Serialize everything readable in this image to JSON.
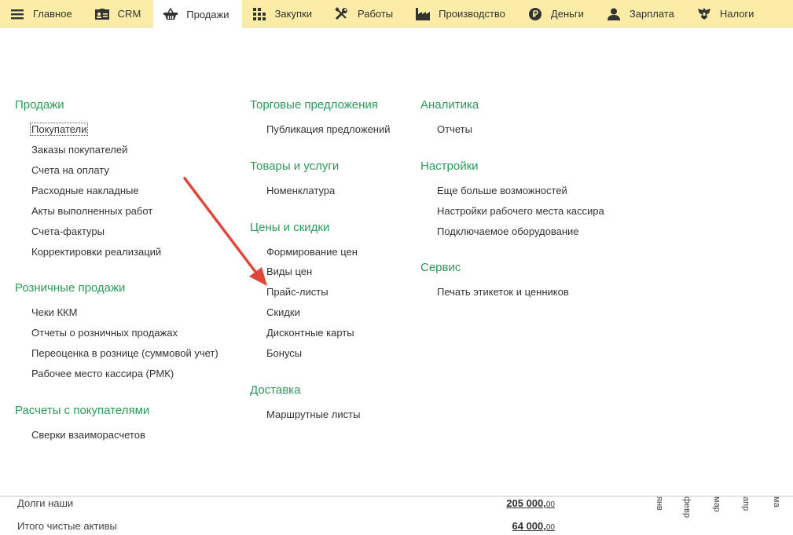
{
  "topnav": {
    "tabs": [
      {
        "label": "Главное",
        "icon": "hamburger-menu-icon",
        "active": false
      },
      {
        "label": "CRM",
        "icon": "crm-card-icon",
        "active": false
      },
      {
        "label": "Продажи",
        "icon": "shopping-basket-icon",
        "active": true
      },
      {
        "label": "Закупки",
        "icon": "purchases-grid-icon",
        "active": false
      },
      {
        "label": "Работы",
        "icon": "tools-icon",
        "active": false
      },
      {
        "label": "Производство",
        "icon": "factory-icon",
        "active": false
      },
      {
        "label": "Деньги",
        "icon": "ruble-coin-icon",
        "active": false
      },
      {
        "label": "Зарплата",
        "icon": "person-icon",
        "active": false
      },
      {
        "label": "Налоги",
        "icon": "emblem-eagle-icon",
        "active": false
      }
    ]
  },
  "menu": {
    "col1": {
      "sales": {
        "title": "Продажи",
        "items": [
          "Покупатели",
          "Заказы покупателей",
          "Счета на оплату",
          "Расходные накладные",
          "Акты выполненных работ",
          "Счета-фактуры",
          "Корректировки реализаций"
        ]
      },
      "retail": {
        "title": "Розничные продажи",
        "items": [
          "Чеки ККМ",
          "Отчеты о розничных продажах",
          "Переоценка в рознице (суммовой учет)",
          "Рабочее место кассира (РМК)"
        ]
      },
      "settlements": {
        "title": "Расчеты с покупателями",
        "items": [
          "Сверки взаиморасчетов"
        ]
      }
    },
    "col2": {
      "offers": {
        "title": "Торговые предложения",
        "items": [
          "Публикация предложений"
        ]
      },
      "goods": {
        "title": "Товары и услуги",
        "items": [
          "Номенклатура"
        ]
      },
      "prices": {
        "title": "Цены и скидки",
        "items": [
          "Формирование цен",
          "Виды цен",
          "Прайс-листы",
          "Скидки",
          "Дисконтные карты",
          "Бонусы"
        ]
      },
      "delivery": {
        "title": "Доставка",
        "items": [
          "Маршрутные листы"
        ]
      }
    },
    "col3": {
      "analytics": {
        "title": "Аналитика",
        "items": [
          "Отчеты"
        ]
      },
      "settings": {
        "title": "Настройки",
        "items": [
          "Еще больше возможностей",
          "Настройки рабочего места кассира",
          "Подключаемое оборудование"
        ]
      },
      "service": {
        "title": "Сервис",
        "items": [
          "Печать этикеток и ценников"
        ]
      }
    }
  },
  "background_panel": {
    "rows": [
      {
        "label": "Долги наши",
        "value_main": "205 000,",
        "value_kop": "00"
      },
      {
        "label": "Итого чистые активы",
        "value_main": "64 000,",
        "value_kop": "00"
      }
    ],
    "months": [
      "янв",
      "февр",
      "мар",
      "апр",
      "ма"
    ]
  },
  "colors": {
    "topbar_bg": "#fbeca7",
    "section_title": "#2a9a5a",
    "arrow": "#e0463a"
  }
}
